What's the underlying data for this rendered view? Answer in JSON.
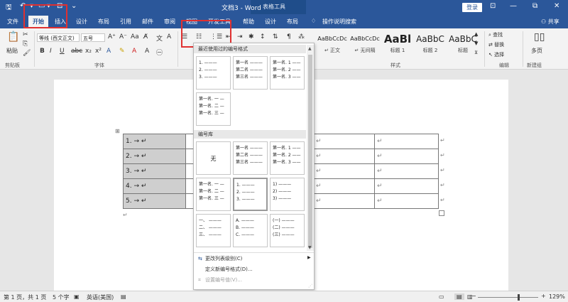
{
  "title_bar": {
    "document_title": "文档3 - Word",
    "context_tools": "表格工具",
    "login": "登录",
    "minimize": "—",
    "restore": "⧉",
    "close": "✕"
  },
  "tabs": {
    "file": "文件",
    "home": "开始",
    "insert": "插入",
    "design": "设计",
    "layout": "布局",
    "references": "引用",
    "mailings": "邮件",
    "review": "审阅",
    "view": "视图",
    "developer": "开发工具",
    "help": "帮助",
    "table_design": "设计",
    "table_layout": "布局",
    "tell_me": "操作说明搜索",
    "share": "共享"
  },
  "ribbon": {
    "clipboard": {
      "paste": "粘贴",
      "label": "剪贴板"
    },
    "font": {
      "name": "等线 (西文正文)",
      "size": "五号",
      "label": "字体",
      "bold": "B",
      "italic": "I",
      "underline": "U"
    },
    "styles": {
      "label": "样式",
      "items": [
        {
          "preview": "AaBbCcDc",
          "name": "↵ 正文"
        },
        {
          "preview": "AaBbCcDc",
          "name": "↵ 无间隔"
        },
        {
          "preview": "AaBl",
          "name": "标题 1"
        },
        {
          "preview": "AaBbC",
          "name": "标题 2"
        },
        {
          "preview": "AaBbC",
          "name": "标题"
        }
      ]
    },
    "editing": {
      "find": "查找",
      "replace": "替换",
      "select": "选择",
      "label": "编辑"
    },
    "new_group": {
      "multipage": "多页",
      "label": "新建组"
    }
  },
  "numbering_panel": {
    "recent_header": "最近使用过的编号格式",
    "recent": [
      [
        "1. ———",
        "2. ———",
        "3. ———"
      ],
      [
        "第一名 ———",
        "第二名 ———",
        "第三名 ———"
      ],
      [
        "第一名. 1 ——",
        "第一名. 2 ——",
        "第一名. 3 ——"
      ],
      [
        "第一名. 一 —",
        "第一名. 二 —",
        "第一名. 三 —"
      ]
    ],
    "library_header": "编号库",
    "none_label": "无",
    "library": [
      [
        "第一名 ———",
        "第二名 ———",
        "第三名 ———"
      ],
      [
        "第一名. 1 ——",
        "第一名. 2 ——",
        "第一名. 3 ——"
      ],
      [
        "第一名. 一 —",
        "第一名. 二 —",
        "第一名. 三 —"
      ],
      [
        "1. ———",
        "2. ———",
        "3. ———"
      ],
      [
        "1) ———",
        "2) ———",
        "3) ———"
      ],
      [
        "一、 ———",
        "二、 ———",
        "三、 ———"
      ],
      [
        "A. ———",
        "B. ———",
        "C. ———"
      ],
      [
        "(一) ———",
        "(二) ———",
        "(三) ———"
      ]
    ],
    "menu": {
      "change_level": "更改列表级别(C)",
      "define_format": "定义新编号格式(D)...",
      "set_value": "设置编号值(V)..."
    }
  },
  "table": {
    "rows": [
      "1. → ↵",
      "2. → ↵",
      "3. → ↵",
      "4. → ↵",
      "5. → ↵"
    ],
    "return_mark": "↵"
  },
  "status_bar": {
    "page": "第 1 页，共 1 页",
    "words": "5 个字",
    "language": "英语(美国)",
    "zoom": "129%"
  }
}
